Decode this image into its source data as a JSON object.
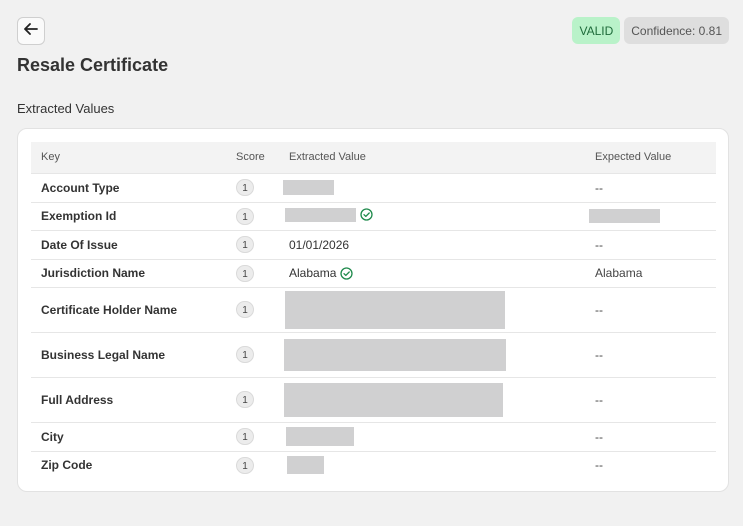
{
  "header": {
    "title": "Resale Certificate",
    "status_badge": "VALID",
    "confidence": "Confidence: 0.81"
  },
  "section": {
    "title": "Extracted Values"
  },
  "table": {
    "columns": [
      "Key",
      "Score",
      "Extracted Value",
      "Expected Value"
    ],
    "rows": [
      {
        "key": "Account Type",
        "score": "1",
        "extracted": "",
        "expected": "--"
      },
      {
        "key": "Exemption Id",
        "score": "1",
        "extracted": "",
        "expected": ""
      },
      {
        "key": "Date Of Issue",
        "score": "1",
        "extracted": "01/01/2026",
        "expected": "--"
      },
      {
        "key": "Jurisdiction Name",
        "score": "1",
        "extracted": "Alabama",
        "expected": "Alabama"
      },
      {
        "key": "Certificate Holder Name",
        "score": "1",
        "extracted": "",
        "expected": "--"
      },
      {
        "key": "Business Legal Name",
        "score": "1",
        "extracted": "",
        "expected": "--"
      },
      {
        "key": "Full Address",
        "score": "1",
        "extracted": "",
        "expected": "--"
      },
      {
        "key": "City",
        "score": "1",
        "extracted": "",
        "expected": "--"
      },
      {
        "key": "Zip Code",
        "score": "1",
        "extracted": "",
        "expected": "--"
      }
    ]
  },
  "icons": {
    "back": "arrow-left-icon",
    "match": "check-circle-icon"
  },
  "colors": {
    "valid_bg": "#b9f2c9",
    "valid_text": "#1e6b3a",
    "check": "#1f8a4c",
    "redaction": "#d0d0d1"
  }
}
